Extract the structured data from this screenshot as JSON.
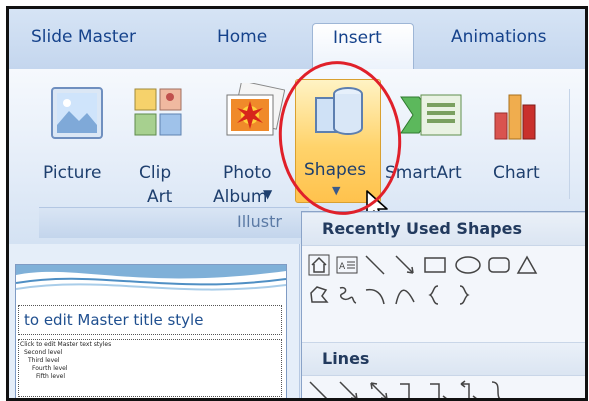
{
  "tabs": {
    "slide_master": "Slide Master",
    "home": "Home",
    "insert": "Insert",
    "animations": "Animations"
  },
  "ribbon": {
    "picture": "Picture",
    "clip_art_1": "Clip",
    "clip_art_2": "Art",
    "photo_album_1": "Photo",
    "photo_album_2": "Album",
    "shapes": "Shapes",
    "smartart": "SmartArt",
    "chart": "Chart",
    "group_label": "Illustr"
  },
  "slide": {
    "title_placeholder": "to edit Master title style",
    "bullets": [
      "Click to edit Master text styles",
      "Second level",
      "Third level",
      "Fourth level",
      "Fifth level"
    ]
  },
  "dropdown": {
    "recent_header": "Recently Used Shapes",
    "lines_header": "Lines"
  },
  "annotation_color": "#e0202a",
  "accent_color": "#ffc24d"
}
